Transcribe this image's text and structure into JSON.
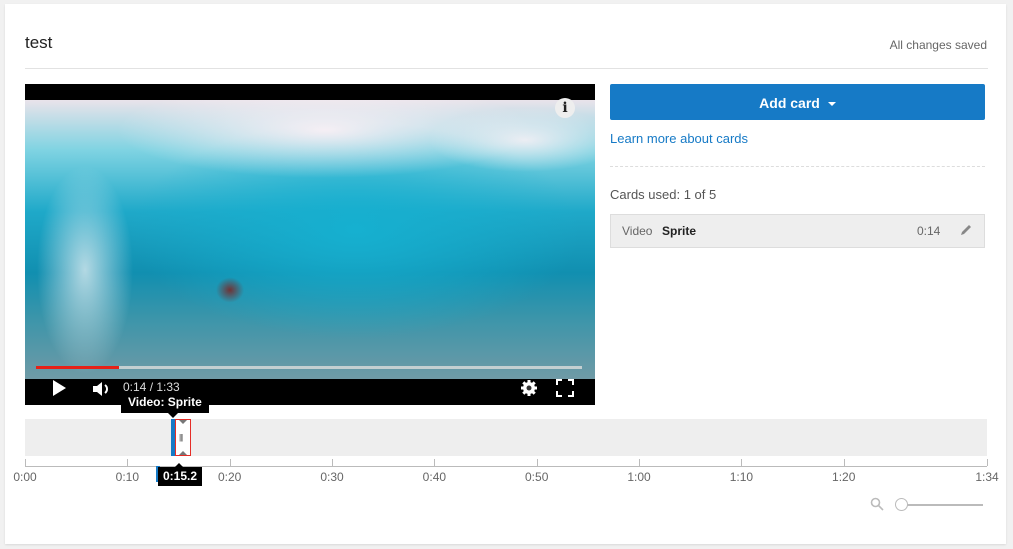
{
  "header": {
    "title": "test",
    "save_status": "All changes saved"
  },
  "player": {
    "current_time": "0:14",
    "duration": "1:33",
    "timecode": "0:14 / 1:33",
    "progress_fraction": 0.152,
    "icons": [
      "info-icon",
      "play-icon",
      "volume-icon",
      "gear-icon",
      "fullscreen-icon"
    ]
  },
  "tooltip": {
    "label": "Video: Sprite"
  },
  "cards_panel": {
    "add_card_label": "Add card",
    "learn_more_label": "Learn more about cards",
    "cards_used": "Cards used: 1 of 5",
    "cards": [
      {
        "type": "Video",
        "name": "Sprite",
        "time": "0:14"
      }
    ]
  },
  "timeline": {
    "cursor_time": "0:15.2",
    "cursor_seconds": 15.2,
    "card_marker_seconds": 15.2,
    "total_seconds": 94,
    "ticks": [
      {
        "label": "0:00",
        "seconds": 0
      },
      {
        "label": "0:10",
        "seconds": 10
      },
      {
        "label": "0:20",
        "seconds": 20
      },
      {
        "label": "0:30",
        "seconds": 30
      },
      {
        "label": "0:40",
        "seconds": 40
      },
      {
        "label": "0:50",
        "seconds": 50
      },
      {
        "label": "1:00",
        "seconds": 60
      },
      {
        "label": "1:10",
        "seconds": 70
      },
      {
        "label": "1:20",
        "seconds": 80
      },
      {
        "label": "1:34",
        "seconds": 94
      }
    ],
    "zoom_level_fraction": 0
  },
  "colors": {
    "accent": "#167ac6",
    "progress": "#e62117",
    "marker_border": "#e52d27"
  }
}
